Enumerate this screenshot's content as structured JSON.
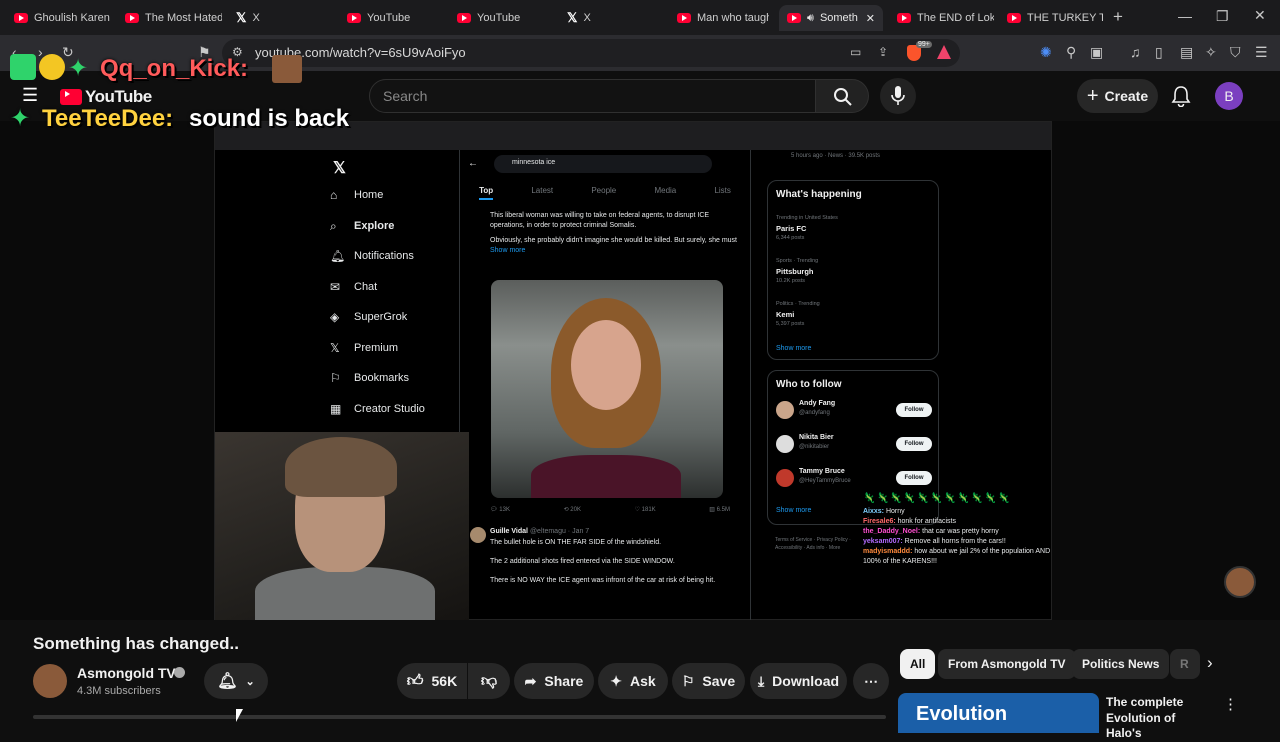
{
  "browser": {
    "tabs": [
      {
        "icon": "youtube",
        "title": "Ghoulish Karen"
      },
      {
        "icon": "youtube",
        "title": "The Most Hated"
      },
      {
        "icon": "x",
        "title": "X"
      },
      {
        "icon": "youtube",
        "title": "YouTube"
      },
      {
        "icon": "youtube",
        "title": "YouTube"
      },
      {
        "icon": "x",
        "title": "X"
      },
      {
        "icon": "youtube",
        "title": "Man who taugh"
      },
      {
        "icon": "youtube",
        "title": "Someth"
      },
      {
        "icon": "youtube",
        "title": "The END of Lok"
      },
      {
        "icon": "youtube",
        "title": "THE TURKEY TO"
      }
    ],
    "new_tab": "+",
    "url": "youtube.com/watch?v=6sU9vAoiFyo",
    "brave_badge": "99+"
  },
  "youtube": {
    "logo": "YouTube",
    "search_placeholder": "Search",
    "create_label": "Create",
    "avatar_letter": "B"
  },
  "stream_overlay": {
    "line1_user": "Qq_on_Kick:",
    "line2_user": "TeeTeeDee:",
    "line2_msg": "sound is back"
  },
  "x_page": {
    "search_text": "minnesota ice",
    "nav": [
      "Home",
      "Explore",
      "Notifications",
      "Chat",
      "SuperGrok",
      "Premium",
      "Bookmarks",
      "Creator Studio"
    ],
    "tabs": [
      "Top",
      "Latest",
      "People",
      "Media",
      "Lists"
    ],
    "post1_text": "This liberal woman was willing to take on federal agents, to disrupt ICE operations, in order to protect criminal Somalis.",
    "post1_text2": "Obviously, she probably didn't imagine she would be killed. But surely, she must",
    "show_more": "Show more",
    "post1_stats": [
      "13K",
      "20K",
      "181K",
      "6.5M"
    ],
    "post2_author": "Guille Vidal",
    "post2_handle": "@eltemagu · Jan 7",
    "post2_line1": "The bullet hole is ON THE FAR SIDE of the windshield.",
    "post2_line2": "The 2 additional shots fired entered via the SIDE WINDOW.",
    "post2_line3": "There is NO WAY the ICE agent was infront of the car at risk of being hit.",
    "news_meta": "5 hours ago · News · 39.5K posts",
    "whats_happening": "What's happening",
    "trends": [
      {
        "meta": "Trending in United States",
        "name": "Paris FC",
        "count": "6,344 posts"
      },
      {
        "meta": "Sports · Trending",
        "name": "Pittsburgh",
        "count": "10.2K posts"
      },
      {
        "meta": "Politics · Trending",
        "name": "Kemi",
        "count": "5,397 posts"
      }
    ],
    "who_to_follow": "Who to follow",
    "follow_suggestions": [
      {
        "name": "Andy Fang",
        "handle": "@andyfang"
      },
      {
        "name": "Nikita Bier",
        "handle": "@nikitabier"
      },
      {
        "name": "Tammy Bruce",
        "handle": "@HeyTammyBruce"
      }
    ],
    "follow_label": "Follow",
    "footer": "Terms of Service · Privacy Policy · Accessibility · Ads info · More"
  },
  "twitch_chat": [
    {
      "user": "Aixxs:",
      "msg": "Horny",
      "color": "#7fd0ff"
    },
    {
      "user": "Firesale6:",
      "msg": "honk for antifacists",
      "color": "#ff6b6b"
    },
    {
      "user": "the_Daddy_Noel:",
      "msg": "that car was pretty horny",
      "color": "#ff4fd0"
    },
    {
      "user": "yeksam007:",
      "msg": "Remove all horns from the cars!!",
      "color": "#b36bff"
    },
    {
      "user": "madyismaddd:",
      "msg": "how about we jail 2% of the population AND 100% of the KARENS!!!",
      "color": "#ff8a3d"
    }
  ],
  "video_info": {
    "title": "Something has changed..",
    "channel": "Asmongold TV",
    "subscribers": "4.3M subscribers",
    "likes": "56K",
    "share": "Share",
    "ask": "Ask",
    "save": "Save",
    "download": "Download"
  },
  "chips": [
    "All",
    "From Asmongold TV",
    "Politics News",
    "R"
  ],
  "recommended": {
    "thumb_text": "Evolution",
    "title": "The complete Evolution of Halo's"
  }
}
